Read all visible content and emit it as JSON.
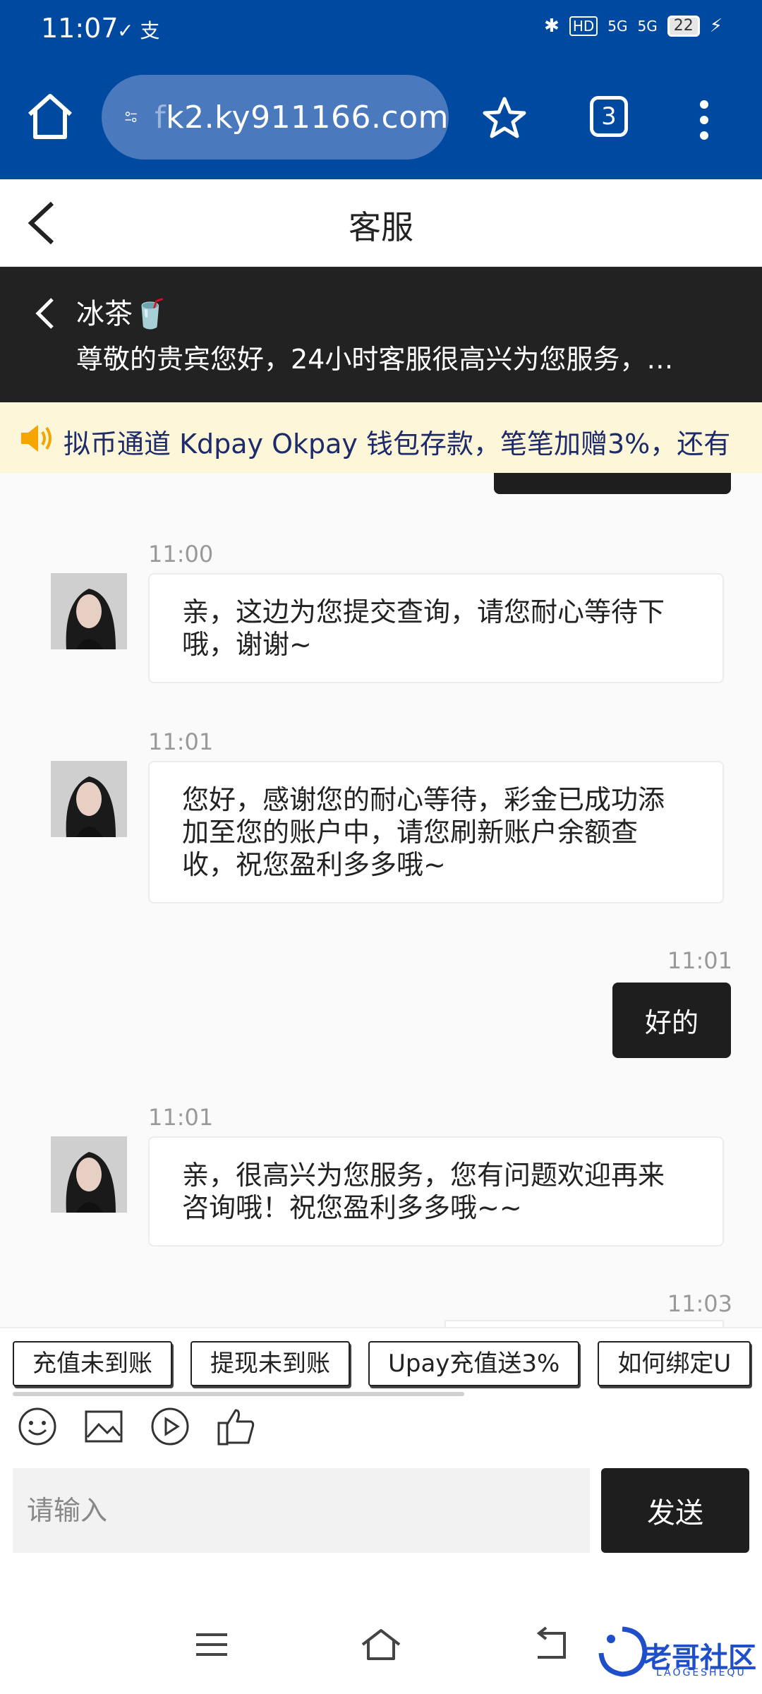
{
  "status_bar": {
    "time": "11:07",
    "left_icons": "✓ 支",
    "bluetooth": "✱",
    "hd": "HD",
    "signal1": "5G",
    "signal2": "5G",
    "battery": "22",
    "charging": "⚡"
  },
  "browser": {
    "url_fade": "f",
    "url": "k2.ky911166.com",
    "tab_count": "3"
  },
  "page": {
    "title": "客服"
  },
  "agent": {
    "name": "冰茶🥤",
    "subtitle": "尊敬的贵宾您好，24小时客服很高兴为您服务，…"
  },
  "marquee": {
    "text": "拟币通道 Kdpay Okpay 钱包存款，笔笔加赠3%，还有"
  },
  "messages": [
    {
      "time": "11:00",
      "text": "亲，这边为您提交查询，请您耐心等待下哦，谢谢~"
    },
    {
      "time": "11:01",
      "text": "您好，感谢您的耐心等待，彩金已成功添加至您的账户中，请您刷新账户余额查收，祝您盈利多多哦~"
    },
    {
      "time": "11:01",
      "text": "好的"
    },
    {
      "time": "11:01",
      "text": "亲，很高兴为您服务，您有问题欢迎再来咨询哦！祝您盈利多多哦~~"
    },
    {
      "time": "11:03"
    }
  ],
  "quick_replies": [
    "充值未到账",
    "提现未到账",
    "Upay充值送3%",
    "如何绑定U"
  ],
  "composer": {
    "placeholder": "请输入",
    "send_label": "发送"
  },
  "watermark": {
    "text": "老哥社区",
    "sub": "LAOGESHEQU"
  }
}
